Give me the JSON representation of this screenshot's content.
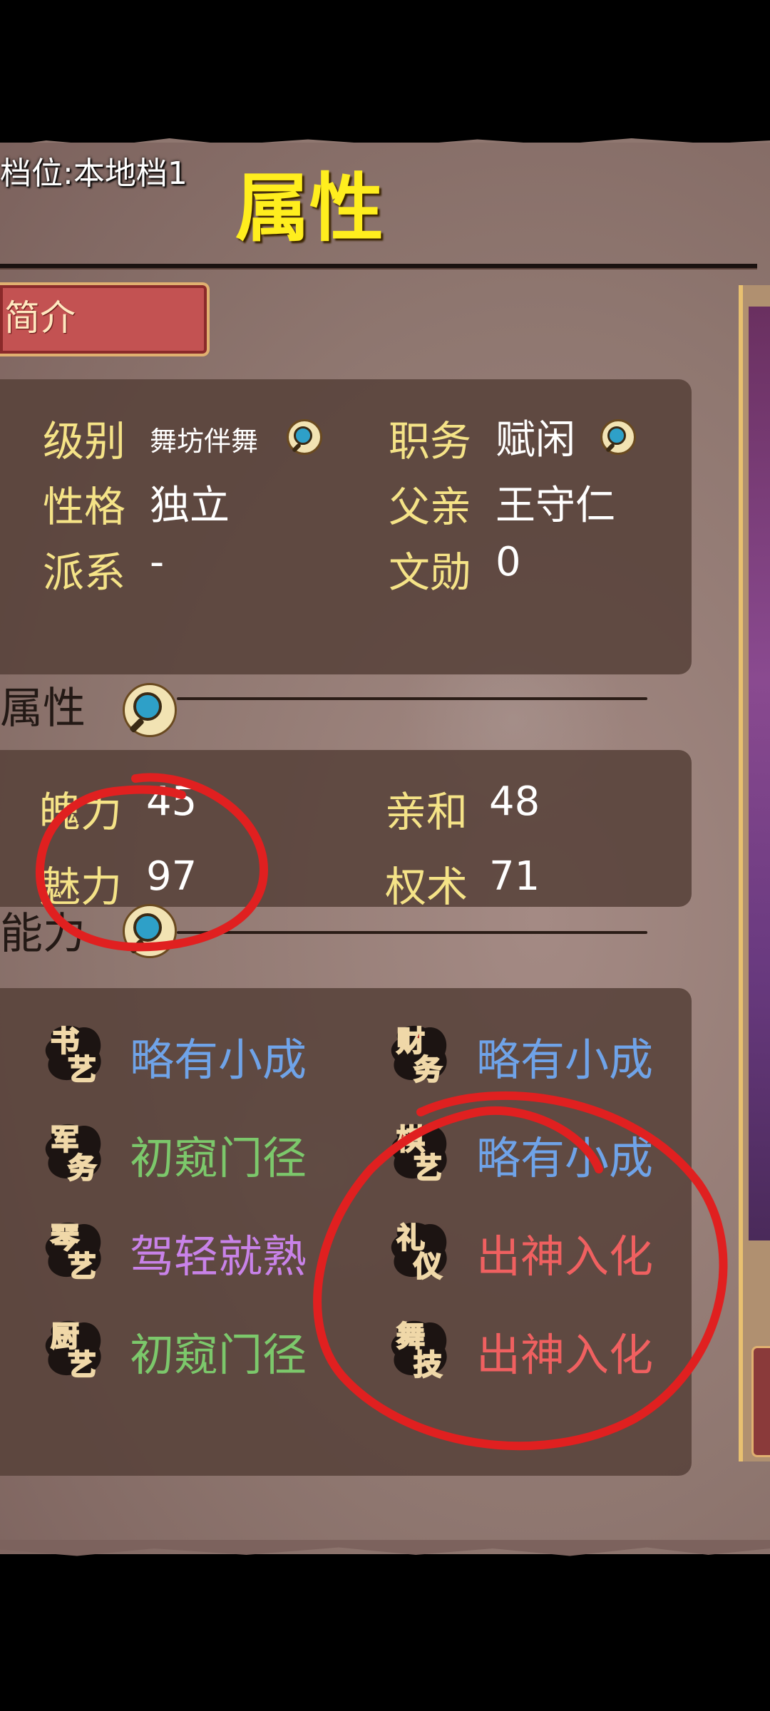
{
  "header": {
    "save_slot": "档位:本地档1",
    "title": "属性"
  },
  "tabs": {
    "intro_label": "简介"
  },
  "profile": {
    "rank_label": "级别",
    "rank_value": "舞坊伴舞",
    "position_label": "职务",
    "position_value": "赋闲",
    "personality_label": "性格",
    "personality_value": "独立",
    "father_label": "父亲",
    "father_value": "王守仁",
    "faction_label": "派系",
    "faction_value": "-",
    "merit_label": "文勋",
    "merit_value": "0"
  },
  "attributes": {
    "section_label": "属性",
    "items": [
      {
        "label": "魄力",
        "value": "45"
      },
      {
        "label": "亲和",
        "value": "48"
      },
      {
        "label": "魅力",
        "value": "97"
      },
      {
        "label": "权术",
        "value": "71"
      }
    ]
  },
  "abilities": {
    "section_label": "能力",
    "items": [
      {
        "seal": "书艺",
        "seal_top": "书",
        "seal_bottom": "艺",
        "value": "略有小成",
        "color": "#6fa3e8"
      },
      {
        "seal": "财务",
        "seal_top": "财",
        "seal_bottom": "务",
        "value": "略有小成",
        "color": "#6fa3e8"
      },
      {
        "seal": "军务",
        "seal_top": "军",
        "seal_bottom": "务",
        "value": "初窥门径",
        "color": "#7cc86b"
      },
      {
        "seal": "棋艺",
        "seal_top": "棋",
        "seal_bottom": "艺",
        "value": "略有小成",
        "color": "#6fa3e8"
      },
      {
        "seal": "琴艺",
        "seal_top": "琴",
        "seal_bottom": "艺",
        "value": "驾轻就熟",
        "color": "#c882e8"
      },
      {
        "seal": "礼仪",
        "seal_top": "礼",
        "seal_bottom": "仪",
        "value": "出神入化",
        "color": "#f06060"
      },
      {
        "seal": "厨艺",
        "seal_top": "厨",
        "seal_bottom": "艺",
        "value": "初窥门径",
        "color": "#7cc86b"
      },
      {
        "seal": "舞技",
        "seal_top": "舞",
        "seal_bottom": "技",
        "value": "出神入化",
        "color": "#f06060"
      }
    ]
  },
  "colors": {
    "title_yellow": "#ffee1e",
    "label_yellow": "#f5e387",
    "annotation_red": "#e02020",
    "seal_red": "#b01818"
  }
}
